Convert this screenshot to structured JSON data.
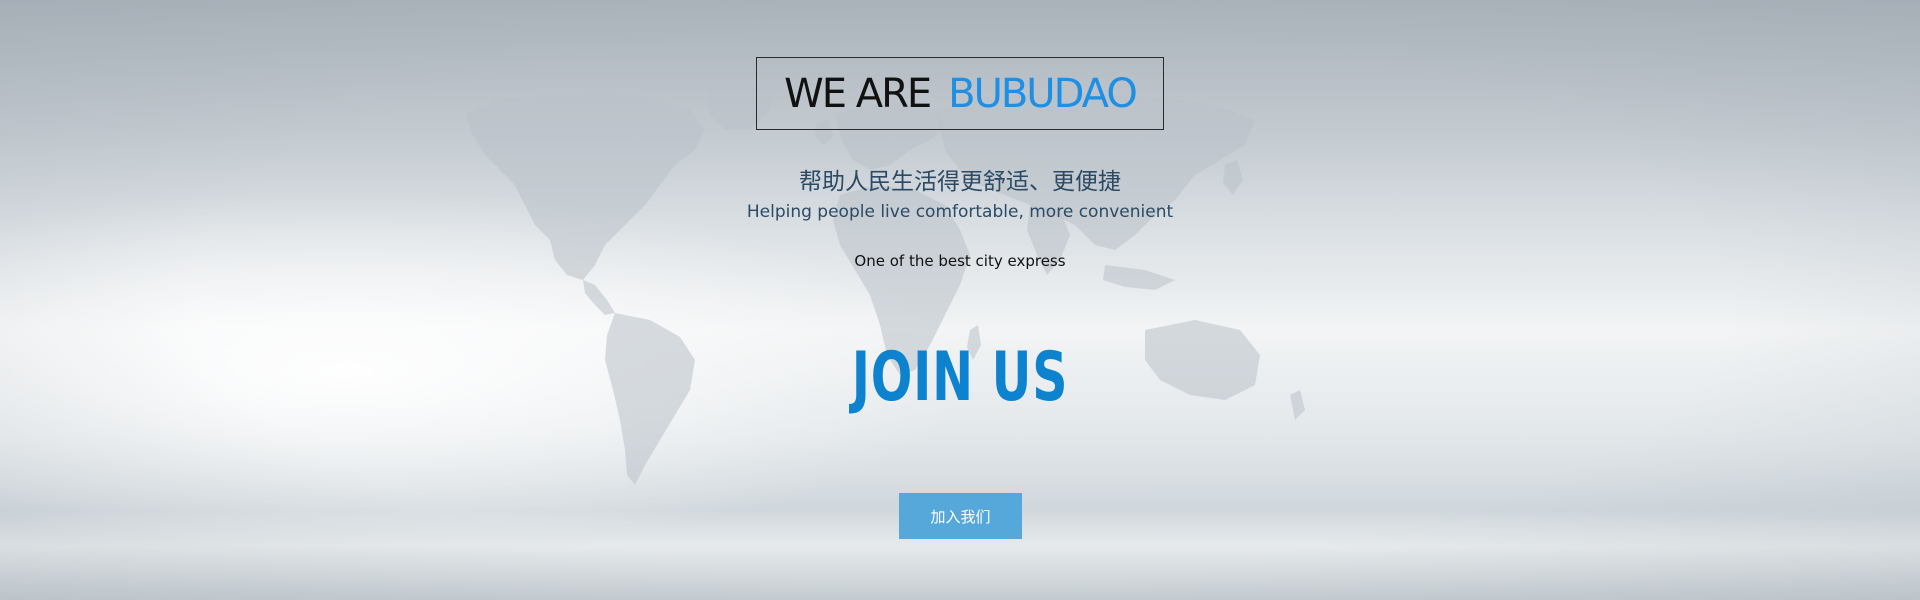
{
  "hero": {
    "title_part1": "WE ARE",
    "title_part2": "BUBUDAO",
    "slogan_cn": "帮助人民生活得更舒适、更便捷",
    "slogan_en": "Helping people live comfortable, more convenient",
    "tagline": "One of the best city express",
    "headline": "JOIN US",
    "button_label": "加入我们"
  },
  "colors": {
    "accent_blue": "#1e8fe3",
    "headline_blue": "#0d83d0",
    "button_bg": "#56a8da",
    "slogan_text": "#2c4a64"
  },
  "icons": {
    "background": "world-map-icon"
  }
}
